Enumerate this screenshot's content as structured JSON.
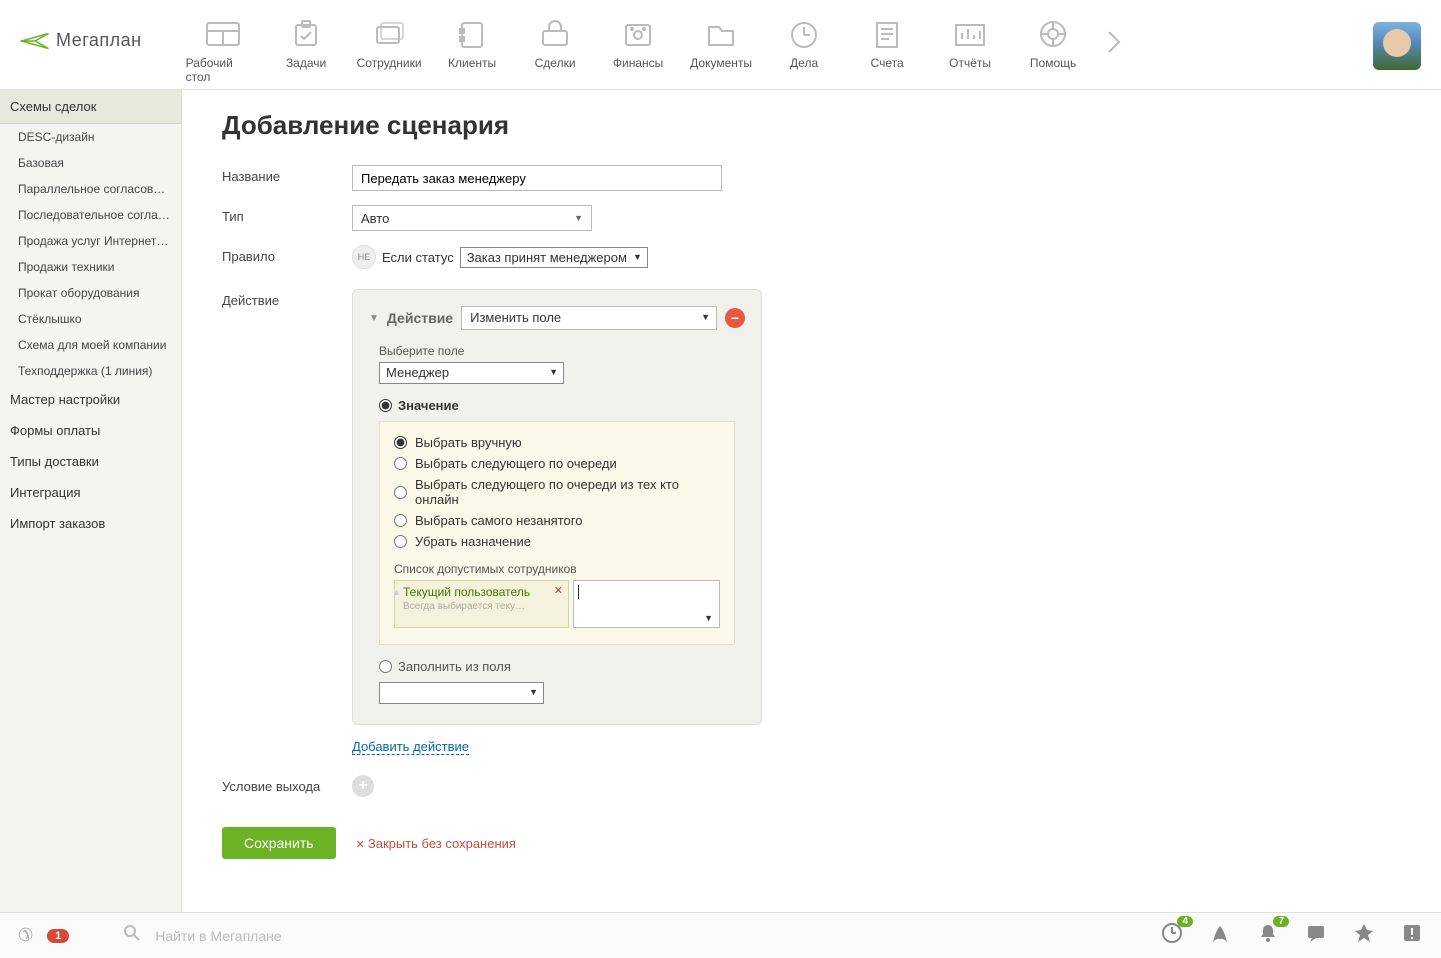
{
  "app": {
    "name": "Мегаплан"
  },
  "nav": [
    {
      "label": "Рабочий стол"
    },
    {
      "label": "Задачи"
    },
    {
      "label": "Сотрудники"
    },
    {
      "label": "Клиенты"
    },
    {
      "label": "Сделки"
    },
    {
      "label": "Финансы"
    },
    {
      "label": "Документы"
    },
    {
      "label": "Дела"
    },
    {
      "label": "Счета"
    },
    {
      "label": "Отчёты"
    },
    {
      "label": "Помощь"
    }
  ],
  "sidebar": {
    "section": "Схемы сделок",
    "items": [
      "DESC-дизайн",
      "Базовая",
      "Параллельное согласование",
      "Последовательное согласов…",
      "Продажа услуг Интернет-аге…",
      "Продажи техники",
      "Прокат оборудования",
      "Стёклышко",
      "Схема для моей компании",
      "Техподдержка (1 линия)"
    ],
    "links": [
      "Мастер настройки",
      "Формы оплаты",
      "Типы доставки",
      "Интеграция",
      "Импорт заказов"
    ]
  },
  "page": {
    "title": "Добавление сценария",
    "labels": {
      "name": "Название",
      "type": "Тип",
      "rule": "Правило",
      "action": "Действие",
      "exit": "Условие выхода"
    },
    "name_value": "Передать заказ менеджеру",
    "type_value": "Авто",
    "rule": {
      "ne": "НЕ",
      "if_status": "Если статус",
      "status_value": "Заказ принят менеджером"
    },
    "action_block": {
      "header_label": "Действие",
      "action_type": "Изменить поле",
      "select_field_label": "Выберите поле",
      "field_value": "Менеджер",
      "value_label": "Значение",
      "options": [
        "Выбрать вручную",
        "Выбрать следующего по очереди",
        "Выбрать следующего по очереди из тех кто онлайн",
        "Выбрать самого незанятого",
        "Убрать назначение"
      ],
      "emp_list_label": "Список допустимых сотрудников",
      "chip_title": "Текущий пользователь",
      "chip_hint": "Всегда выбирается теку…",
      "fill_from_field": "Заполнить из поля",
      "add_action": "Добавить действие"
    },
    "buttons": {
      "save": "Сохранить",
      "cancel": "Закрыть без сохранения"
    }
  },
  "footer": {
    "phone_badge": "1",
    "search_placeholder": "Найти в Мегаплане",
    "clock_badge": "4",
    "bell_badge": "7"
  }
}
